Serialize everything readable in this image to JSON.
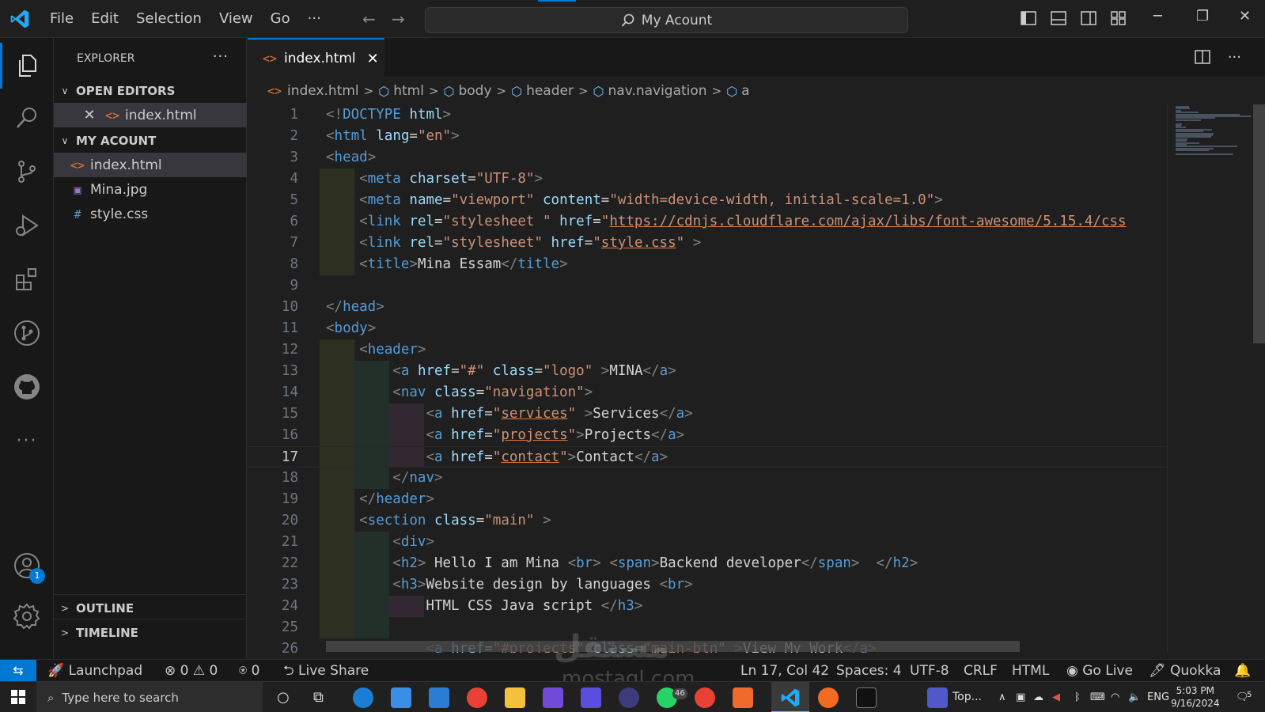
{
  "titlebar": {
    "menu": [
      "File",
      "Edit",
      "Selection",
      "View",
      "Go",
      "···"
    ],
    "command_center": "My Acount",
    "window_buttons": [
      "─",
      "❐",
      "✕"
    ]
  },
  "activity": {
    "account_badge": "1"
  },
  "sidebar": {
    "title": "EXPLORER",
    "more": "···",
    "open_editors_label": "OPEN EDITORS",
    "open_editors": [
      {
        "name": "index.html",
        "icon": "html-file-icon"
      }
    ],
    "project_label": "MY ACOUNT",
    "files": [
      {
        "name": "index.html",
        "icon": "html-file-icon",
        "glyph": "<>"
      },
      {
        "name": "Mina.jpg",
        "icon": "image-file-icon",
        "glyph": "▣"
      },
      {
        "name": "style.css",
        "icon": "css-file-icon",
        "glyph": "#"
      }
    ],
    "outline_label": "OUTLINE",
    "timeline_label": "TIMELINE"
  },
  "editor": {
    "tab_label": "index.html",
    "breadcrumb": [
      "index.html",
      "html",
      "body",
      "header",
      "nav.navigation",
      "a"
    ],
    "current_line": 17,
    "lines": [
      [
        [
          "b",
          "<!"
        ],
        [
          "tag",
          "DOCTYPE"
        ],
        [
          "txt",
          " "
        ],
        [
          "attr",
          "html"
        ],
        [
          "b",
          ">"
        ]
      ],
      [
        [
          "b",
          "<"
        ],
        [
          "tag",
          "html"
        ],
        [
          "txt",
          " "
        ],
        [
          "attr",
          "lang"
        ],
        [
          "txt",
          "="
        ],
        [
          "str",
          "\"en\""
        ],
        [
          "b",
          ">"
        ]
      ],
      [
        [
          "b",
          "<"
        ],
        [
          "tag",
          "head"
        ],
        [
          "b",
          ">"
        ]
      ],
      [
        [
          "txt",
          "    "
        ],
        [
          "b",
          "<"
        ],
        [
          "tag",
          "meta"
        ],
        [
          "txt",
          " "
        ],
        [
          "attr",
          "charset"
        ],
        [
          "txt",
          "="
        ],
        [
          "str",
          "\"UTF-8\""
        ],
        [
          "b",
          ">"
        ]
      ],
      [
        [
          "txt",
          "    "
        ],
        [
          "b",
          "<"
        ],
        [
          "tag",
          "meta"
        ],
        [
          "txt",
          " "
        ],
        [
          "attr",
          "name"
        ],
        [
          "txt",
          "="
        ],
        [
          "str",
          "\"viewport\""
        ],
        [
          "txt",
          " "
        ],
        [
          "attr",
          "content"
        ],
        [
          "txt",
          "="
        ],
        [
          "str",
          "\"width=device-width, initial-scale=1.0\""
        ],
        [
          "b",
          ">"
        ]
      ],
      [
        [
          "txt",
          "    "
        ],
        [
          "b",
          "<"
        ],
        [
          "tag",
          "link"
        ],
        [
          "txt",
          " "
        ],
        [
          "attr",
          "rel"
        ],
        [
          "txt",
          "="
        ],
        [
          "str",
          "\"stylesheet \""
        ],
        [
          "txt",
          " "
        ],
        [
          "attr",
          "href"
        ],
        [
          "txt",
          "="
        ],
        [
          "str",
          "\""
        ],
        [
          "strul",
          "https://cdnjs.cloudflare.com/ajax/libs/font-awesome/5.15.4/css"
        ]
      ],
      [
        [
          "txt",
          "    "
        ],
        [
          "b",
          "<"
        ],
        [
          "tag",
          "link"
        ],
        [
          "txt",
          " "
        ],
        [
          "attr",
          "rel"
        ],
        [
          "txt",
          "="
        ],
        [
          "str",
          "\"stylesheet\""
        ],
        [
          "txt",
          " "
        ],
        [
          "attr",
          "href"
        ],
        [
          "txt",
          "="
        ],
        [
          "str",
          "\""
        ],
        [
          "strul",
          "style.css"
        ],
        [
          "str",
          "\""
        ],
        [
          "txt",
          " "
        ],
        [
          "b",
          ">"
        ]
      ],
      [
        [
          "txt",
          "    "
        ],
        [
          "b",
          "<"
        ],
        [
          "tag",
          "title"
        ],
        [
          "b",
          ">"
        ],
        [
          "txt",
          "Mina Essam"
        ],
        [
          "b",
          "</"
        ],
        [
          "tag",
          "title"
        ],
        [
          "b",
          ">"
        ]
      ],
      [],
      [
        [
          "b",
          "</"
        ],
        [
          "tag",
          "head"
        ],
        [
          "b",
          ">"
        ]
      ],
      [
        [
          "b",
          "<"
        ],
        [
          "tag",
          "body"
        ],
        [
          "b",
          ">"
        ]
      ],
      [
        [
          "txt",
          "    "
        ],
        [
          "b",
          "<"
        ],
        [
          "tag",
          "header"
        ],
        [
          "b",
          ">"
        ]
      ],
      [
        [
          "txt",
          "        "
        ],
        [
          "b",
          "<"
        ],
        [
          "tag",
          "a"
        ],
        [
          "txt",
          " "
        ],
        [
          "attr",
          "href"
        ],
        [
          "txt",
          "="
        ],
        [
          "str",
          "\"#\""
        ],
        [
          "txt",
          " "
        ],
        [
          "attr",
          "class"
        ],
        [
          "txt",
          "="
        ],
        [
          "str",
          "\"logo\""
        ],
        [
          "txt",
          " "
        ],
        [
          "b",
          ">"
        ],
        [
          "txt",
          "MINA"
        ],
        [
          "b",
          "</"
        ],
        [
          "tag",
          "a"
        ],
        [
          "b",
          ">"
        ]
      ],
      [
        [
          "txt",
          "        "
        ],
        [
          "b",
          "<"
        ],
        [
          "tag",
          "nav"
        ],
        [
          "txt",
          " "
        ],
        [
          "attr",
          "class"
        ],
        [
          "txt",
          "="
        ],
        [
          "str",
          "\"navigation\""
        ],
        [
          "b",
          ">"
        ]
      ],
      [
        [
          "txt",
          "            "
        ],
        [
          "b",
          "<"
        ],
        [
          "tag",
          "a"
        ],
        [
          "txt",
          " "
        ],
        [
          "attr",
          "href"
        ],
        [
          "txt",
          "="
        ],
        [
          "str",
          "\""
        ],
        [
          "strul",
          "services"
        ],
        [
          "str",
          "\""
        ],
        [
          "txt",
          " "
        ],
        [
          "b",
          ">"
        ],
        [
          "txt",
          "Services"
        ],
        [
          "b",
          "</"
        ],
        [
          "tag",
          "a"
        ],
        [
          "b",
          ">"
        ]
      ],
      [
        [
          "txt",
          "            "
        ],
        [
          "b",
          "<"
        ],
        [
          "tag",
          "a"
        ],
        [
          "txt",
          " "
        ],
        [
          "attr",
          "href"
        ],
        [
          "txt",
          "="
        ],
        [
          "str",
          "\""
        ],
        [
          "strul",
          "projects"
        ],
        [
          "str",
          "\""
        ],
        [
          "b",
          ">"
        ],
        [
          "txt",
          "Projects"
        ],
        [
          "b",
          "</"
        ],
        [
          "tag",
          "a"
        ],
        [
          "b",
          ">"
        ]
      ],
      [
        [
          "txt",
          "            "
        ],
        [
          "b",
          "<"
        ],
        [
          "tag",
          "a"
        ],
        [
          "txt",
          " "
        ],
        [
          "attr",
          "href"
        ],
        [
          "txt",
          "="
        ],
        [
          "str",
          "\""
        ],
        [
          "strul",
          "contact"
        ],
        [
          "str",
          "\""
        ],
        [
          "b",
          ">"
        ],
        [
          "txt",
          "Contact"
        ],
        [
          "b",
          "</"
        ],
        [
          "tag",
          "a"
        ],
        [
          "b",
          ">"
        ]
      ],
      [
        [
          "txt",
          "        "
        ],
        [
          "b",
          "</"
        ],
        [
          "tag",
          "nav"
        ],
        [
          "b",
          ">"
        ]
      ],
      [
        [
          "txt",
          "    "
        ],
        [
          "b",
          "</"
        ],
        [
          "tag",
          "header"
        ],
        [
          "b",
          ">"
        ]
      ],
      [
        [
          "txt",
          "    "
        ],
        [
          "b",
          "<"
        ],
        [
          "tag",
          "section"
        ],
        [
          "txt",
          " "
        ],
        [
          "attr",
          "class"
        ],
        [
          "txt",
          "="
        ],
        [
          "str",
          "\"main\""
        ],
        [
          "txt",
          " "
        ],
        [
          "b",
          ">"
        ]
      ],
      [
        [
          "txt",
          "        "
        ],
        [
          "b",
          "<"
        ],
        [
          "tag",
          "div"
        ],
        [
          "b",
          ">"
        ]
      ],
      [
        [
          "txt",
          "        "
        ],
        [
          "b",
          "<"
        ],
        [
          "tag",
          "h2"
        ],
        [
          "b",
          ">"
        ],
        [
          "txt",
          " Hello I am Mina "
        ],
        [
          "b",
          "<"
        ],
        [
          "tag",
          "br"
        ],
        [
          "b",
          ">"
        ],
        [
          "txt",
          " "
        ],
        [
          "b",
          "<"
        ],
        [
          "tag",
          "span"
        ],
        [
          "b",
          ">"
        ],
        [
          "txt",
          "Backend developer"
        ],
        [
          "b",
          "</"
        ],
        [
          "tag",
          "span"
        ],
        [
          "b",
          ">"
        ],
        [
          "txt",
          "  "
        ],
        [
          "b",
          "</"
        ],
        [
          "tag",
          "h2"
        ],
        [
          "b",
          ">"
        ]
      ],
      [
        [
          "txt",
          "        "
        ],
        [
          "b",
          "<"
        ],
        [
          "tag",
          "h3"
        ],
        [
          "b",
          ">"
        ],
        [
          "txt",
          "Website design by languages "
        ],
        [
          "b",
          "<"
        ],
        [
          "tag",
          "br"
        ],
        [
          "b",
          ">"
        ]
      ],
      [
        [
          "txt",
          "            HTML CSS Java script "
        ],
        [
          "b",
          "</"
        ],
        [
          "tag",
          "h3"
        ],
        [
          "b",
          ">"
        ]
      ],
      [],
      [
        [
          "txt",
          "            "
        ],
        [
          "b",
          "<"
        ],
        [
          "tag",
          "a"
        ],
        [
          "txt",
          " "
        ],
        [
          "attr",
          "href"
        ],
        [
          "txt",
          "="
        ],
        [
          "str",
          "\"#projects\""
        ],
        [
          "txt",
          " "
        ],
        [
          "attr",
          "class"
        ],
        [
          "txt",
          "="
        ],
        [
          "str",
          "\"main-btn\""
        ],
        [
          "txt",
          " "
        ],
        [
          "b",
          ">"
        ],
        [
          "txt",
          "View My Work"
        ],
        [
          "b",
          "</"
        ],
        [
          "tag",
          "a"
        ],
        [
          "b",
          ">"
        ]
      ]
    ]
  },
  "statusbar": {
    "launchpad": "Launchpad",
    "errors": "0",
    "warnings": "0",
    "ports": "0",
    "live_share": "Live Share",
    "position": "Ln 17, Col 42",
    "spaces": "Spaces: 4",
    "encoding": "UTF-8",
    "eol": "CRLF",
    "language": "HTML",
    "go_live": "Go Live",
    "quokka": "Quokka"
  },
  "taskbar": {
    "search_placeholder": "Type here to search",
    "teams_label": "Top...",
    "whatsapp_badge": "46",
    "language": "ENG",
    "time": "5:03 PM",
    "date": "9/16/2024",
    "notification_count": "5"
  },
  "watermark": {
    "arabic": "مستقل",
    "latin": "mostaql.com"
  },
  "colors": {
    "accent": "#0078d4",
    "tag": "#569cd6",
    "attr": "#9cdcfe",
    "string": "#ce9178",
    "html_icon": "#e37933",
    "css_icon": "#519aba"
  }
}
